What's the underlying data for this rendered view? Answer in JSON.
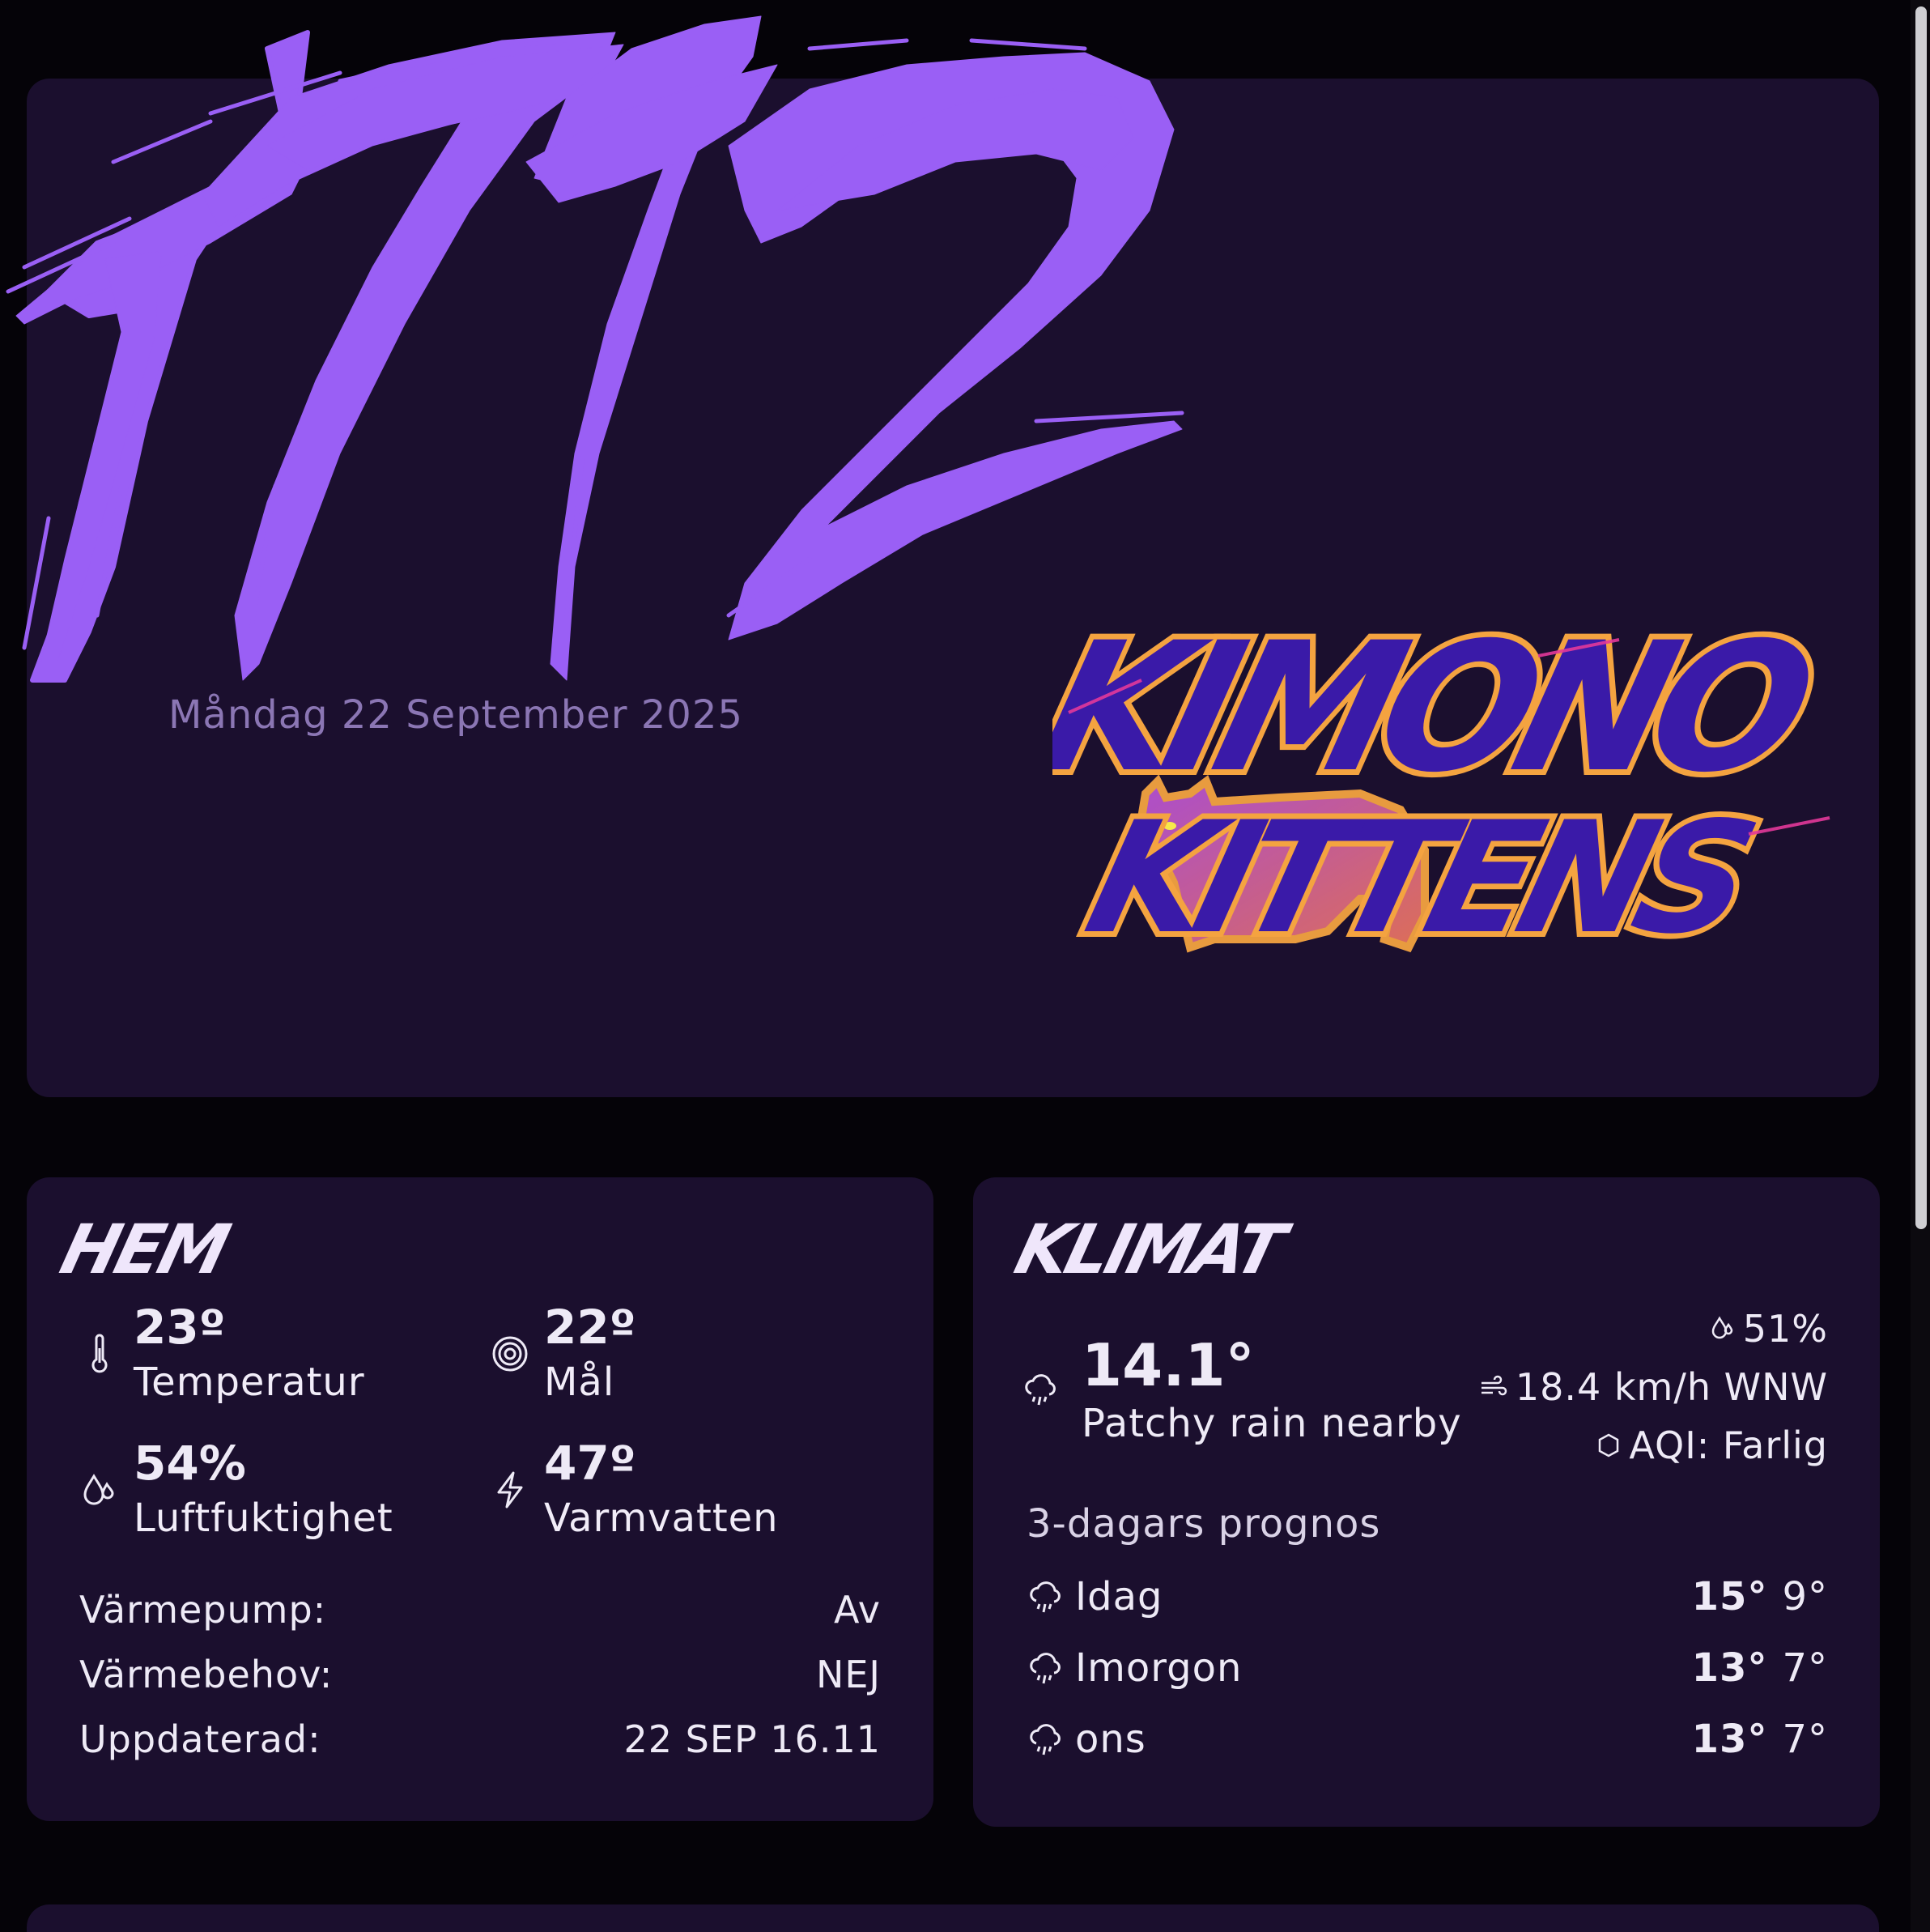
{
  "hero": {
    "clock": "17:12",
    "date": "Måndag 22 September 2025",
    "logo_line1": "KIMONO",
    "logo_line2": "KITTENS"
  },
  "hem": {
    "title": "HEM",
    "stats": [
      {
        "value": "23º",
        "label": "Temperatur",
        "icon": "thermometer-icon"
      },
      {
        "value": "22º",
        "label": "Mål",
        "icon": "target-icon"
      },
      {
        "value": "54%",
        "label": "Luftfuktighet",
        "icon": "humidity-icon"
      },
      {
        "value": "47º",
        "label": "Varmvatten",
        "icon": "bolt-icon"
      }
    ],
    "rows": [
      {
        "key": "Värmepump:",
        "value": "Av"
      },
      {
        "key": "Värmebehov:",
        "value": "NEJ"
      },
      {
        "key": "Uppdaterad:",
        "value": "22 SEP 16.11"
      }
    ]
  },
  "klimat": {
    "title": "KLIMAT",
    "temp": "14.1°",
    "condition": "Patchy rain nearby",
    "humidity": "51%",
    "wind": "18.4 km/h WNW",
    "aqi": "AQI: Farlig",
    "forecast_title": "3-dagars prognos",
    "forecast": [
      {
        "day": "Idag",
        "hi": "15°",
        "lo": "9°"
      },
      {
        "day": "Imorgon",
        "hi": "13°",
        "lo": "7°"
      },
      {
        "day": "ons",
        "hi": "13°",
        "lo": "7°"
      }
    ]
  },
  "colors": {
    "background": "#050308",
    "card": "#1b0f2e",
    "clock": "#9a5ff5",
    "date": "#8b76b4",
    "logo_fill": "#3a1aa8",
    "logo_outline": "#f4a340"
  }
}
